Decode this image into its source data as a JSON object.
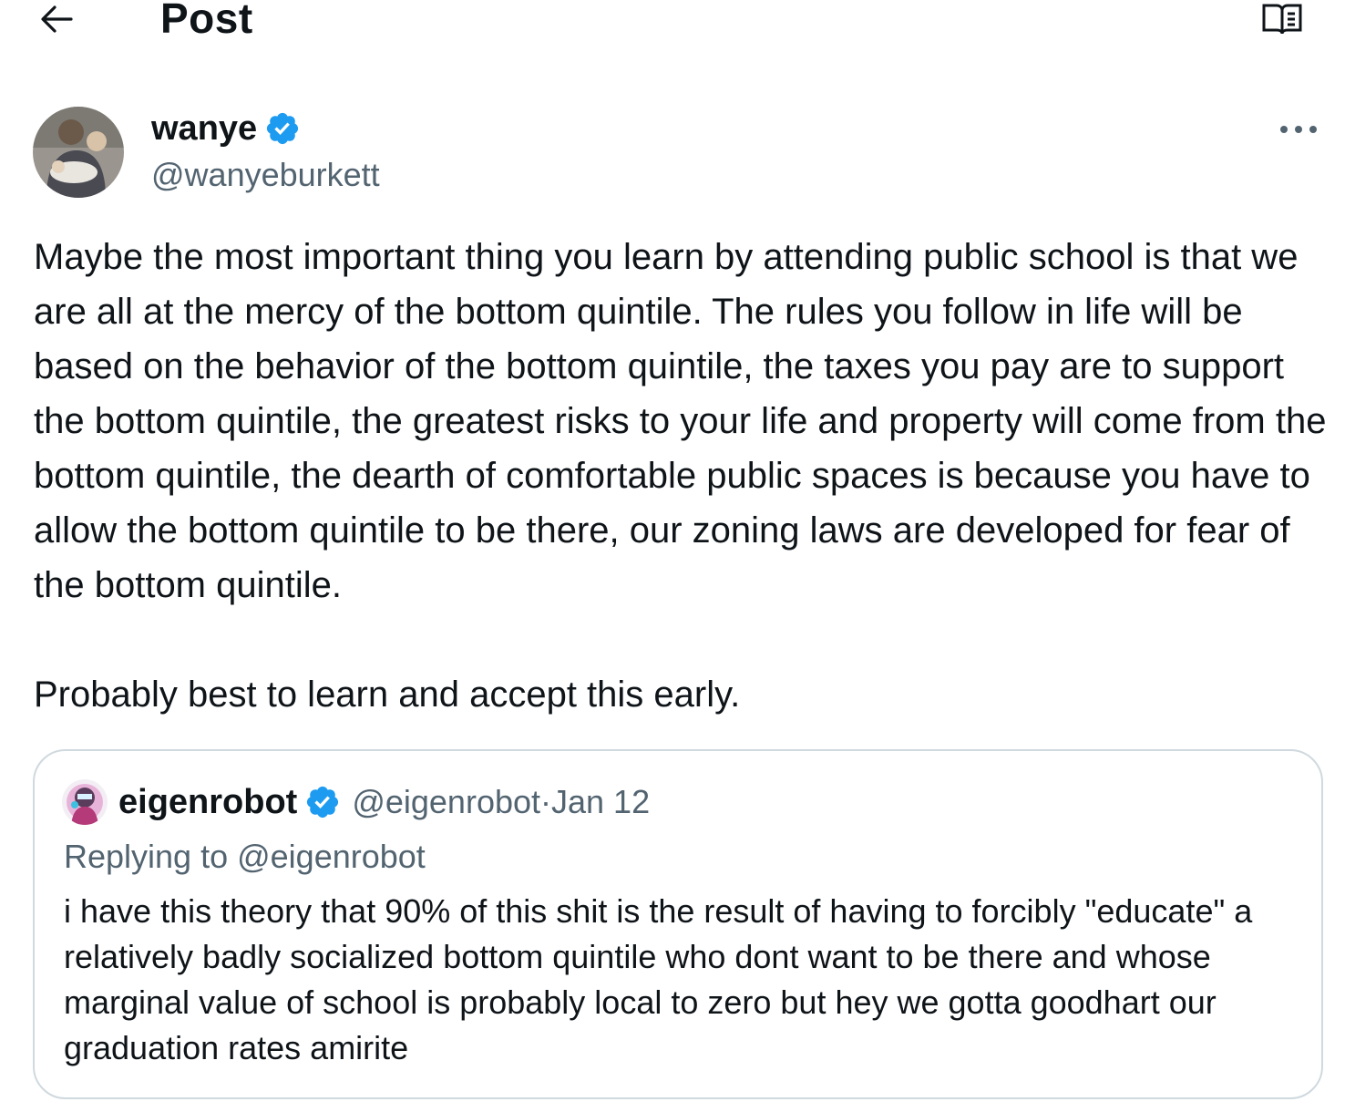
{
  "header": {
    "title": "Post"
  },
  "icons": {
    "back": "arrow-left-icon",
    "reader": "book-open-icon",
    "more": "more-horizontal-icon",
    "verified": "verified-badge-icon"
  },
  "colors": {
    "verified": "#1d9bf0",
    "secondary_text": "#536471",
    "border": "#cfd9de"
  },
  "author": {
    "name": "wanye",
    "handle": "@wanyeburkett"
  },
  "post": {
    "text": "Maybe the most important thing you learn by attending public school is that we are all at the mercy of the bottom quintile. The rules you follow in life will be based on the behavior of the bottom quintile, the taxes you pay are to support the bottom quintile, the greatest risks to your life and property will come from the bottom quintile, the dearth of comfortable public spaces is because you have to allow the bottom quintile to be there, our zoning laws are developed for fear of the bottom quintile.\n\nProbably best to learn and accept this early."
  },
  "quote": {
    "name": "eigenrobot",
    "handle": "@eigenrobot",
    "separator": " · ",
    "date": "Jan 12",
    "replying_prefix": "Replying to ",
    "replying_to": "@eigenrobot",
    "text": "i have this theory that 90% of this shit is the result of having to forcibly \"educate\" a relatively badly socialized bottom quintile who dont want to be there and whose marginal value of school is probably local to zero but hey we gotta goodhart our graduation rates amirite"
  }
}
